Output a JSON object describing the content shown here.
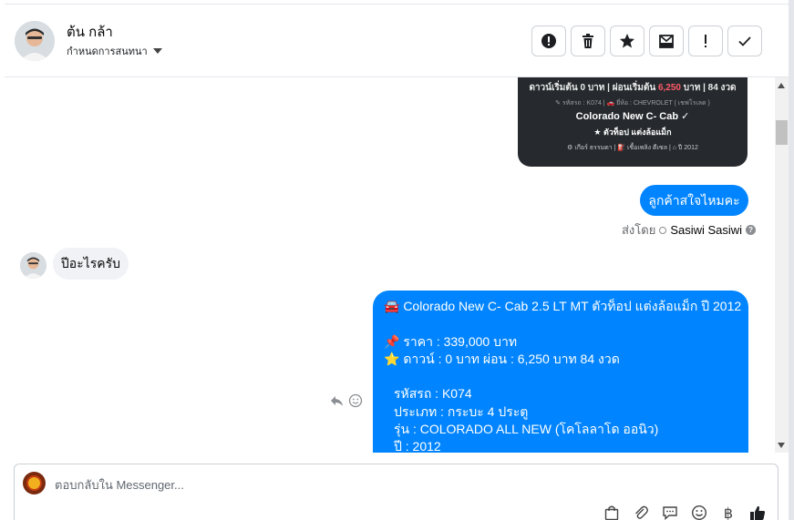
{
  "header": {
    "contact_name": "ต้น กล้า",
    "contact_sub": "กำหนดการสนทนา",
    "actions": [
      "mark-spam",
      "delete",
      "star",
      "archive",
      "mark-important",
      "mark-done"
    ]
  },
  "conversation": {
    "card": {
      "line1_a": "ดาวน์เริ่มต้น 0 บาท | ผ่อนเริ่มต้น ",
      "line1_red": "6,250",
      "line1_b": " บาท | 84 งวด",
      "line2": "✎ รหัสรถ : K074 | 🚗 ยี่ห้อ : CHEVROLET ( เชฟโรเลต )",
      "line3": "Colorado New C- Cab ✓",
      "line4": "★ ตัวท็อป แต่งล้อแม็ก",
      "line5": "⚙ เกียร์ ธรรมดา | ⛽ เชื้อเพลิง ดีเซล | ⌂ ปี 2012"
    },
    "msg1": "ลูกค้าสใจไหมคะ",
    "sent_by_label": "ส่งโดย",
    "sent_by_name": "Sasiwi Sasiwi",
    "msg2": "ปีอะไรครับ",
    "msg3": {
      "l1": "🚘 Colorado New C- Cab 2.5 LT MT ตัวท็อป แต่งล้อแม็ก ปี 2012",
      "l2": "📌 ราคา : 339,000 บาท",
      "l3": "⭐ ดาวน์ : 0 บาท ผ่อน : 6,250 บาท 84 งวด",
      "l4": "รหัสรถ : K074",
      "l5": "ประเภท : กระบะ 4 ประตู",
      "l6": "รุ่น : COLORADO ALL NEW (โคโลลาโด ออนิว)",
      "l7": "ปี : 2012"
    }
  },
  "composer": {
    "placeholder": "ตอบกลับใน Messenger..."
  },
  "colors": {
    "blue_bubble": "#0084ff",
    "gray_bubble": "#f0f2f5",
    "card_bg": "#262a2e",
    "accent_red": "#ff5a6a"
  }
}
